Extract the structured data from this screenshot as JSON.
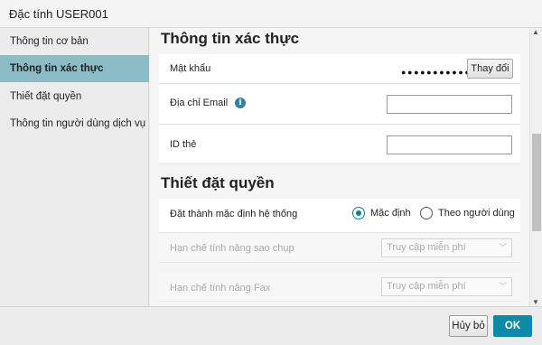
{
  "window": {
    "title": "Đặc tính USER001"
  },
  "sidebar": {
    "items": [
      {
        "label": "Thông tin cơ bản",
        "active": false
      },
      {
        "label": "Thông tin xác thực",
        "active": true
      },
      {
        "label": "Thiết đặt quyền",
        "active": false
      },
      {
        "label": "Thông tin người dùng dịch vụ",
        "active": false
      }
    ]
  },
  "auth_section": {
    "title": "Thông tin xác thực",
    "password": {
      "label": "Mật khẩu",
      "masked_value": "●●●●●●●●●●●●",
      "change_button": "Thay đổi"
    },
    "email": {
      "label": "Địa chỉ Email",
      "info_icon": "i",
      "value": ""
    },
    "card_id": {
      "label": "ID thẻ",
      "value": ""
    }
  },
  "perm_section": {
    "title": "Thiết đặt quyền",
    "system_default": {
      "label": "Đặt thành mặc định hệ thống",
      "options": [
        "Mặc định",
        "Theo người dùng"
      ],
      "selected": "Mặc định"
    },
    "copy_restrict": {
      "label": "Hạn chế tính năng sao chụp",
      "value": "Truy cập miễn phí",
      "chevron": "﹀"
    },
    "fax_restrict": {
      "label": "Hạn chế tính năng Fax",
      "value": "Truy cập miễn phí",
      "chevron": "﹀"
    }
  },
  "scrollbar": {
    "up": "▲",
    "down": "▼"
  },
  "footer": {
    "cancel_label": "Hủy bỏ",
    "ok_label": "OK"
  },
  "colors": {
    "accent": "#0e8aa6",
    "sidebar_active": "#8cbcc6",
    "info_icon": "#2e7fa8"
  }
}
